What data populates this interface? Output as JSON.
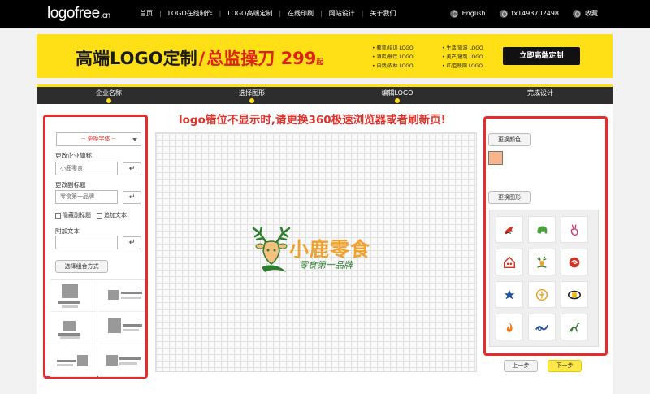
{
  "header": {
    "logo_main": "logofree",
    "logo_suffix": ".cn",
    "nav": [
      "首页",
      "LOGO在线制作",
      "LOGO高端定制",
      "在线印刷",
      "网站设计",
      "关于我们"
    ],
    "language": "English",
    "account": "fx1493702498",
    "favorites": "收藏"
  },
  "banner": {
    "title_part1": "高端LOGO定制",
    "title_part2": "总监操刀",
    "price": "299",
    "price_suffix": "起",
    "categories": [
      "教育/培训 LOGO",
      "生活/旅游 LOGO",
      "酒店/餐饮 LOGO",
      "美产/建筑 LOGO",
      "自然/农林 LOGO",
      "IT/互联网 LOGO"
    ],
    "cta": "立即高端定制"
  },
  "steps": [
    "企业名称",
    "选择图形",
    "编辑LOGO",
    "完成设计"
  ],
  "warning": "logo错位不显示时,请更换360极速浏览器或者刷新页!",
  "editor": {
    "font_select": "-- 更换字体 --",
    "company_label": "更改企业简称",
    "company_value": "小鹿零食",
    "subtitle_label": "更改副标题",
    "subtitle_value": "零食第一品牌",
    "hide_subtitle": "隐藏副标题",
    "add_text_check": "追加文本",
    "extra_text_label": "附加文本",
    "extra_text_value": "",
    "combo_button": "选择组合方式",
    "enter_symbol": "↵"
  },
  "canvas": {
    "brand_name": "小鹿零食",
    "slogan": "零食第一品牌"
  },
  "colors": {
    "accent": "#ffdf16",
    "highlight": "#e62b2b",
    "selected_color": "#f8b58c",
    "brand_orange": "#f0a02c",
    "brand_green": "#2e7c2e"
  },
  "right": {
    "change_color": "更换颜色",
    "change_shape": "更换图形",
    "icons": [
      "bird-red-icon",
      "elephant-green-icon",
      "rabbit-red-icon",
      "house-red-icon",
      "deer-green-icon",
      "swirl-red-icon",
      "star-blue-icon",
      "tree-circle-orange-icon",
      "ring-knot-icon",
      "flame-orange-icon",
      "wave-blue-icon",
      "deer-jump-green-icon"
    ],
    "prev": "上一步",
    "next": "下一步"
  }
}
